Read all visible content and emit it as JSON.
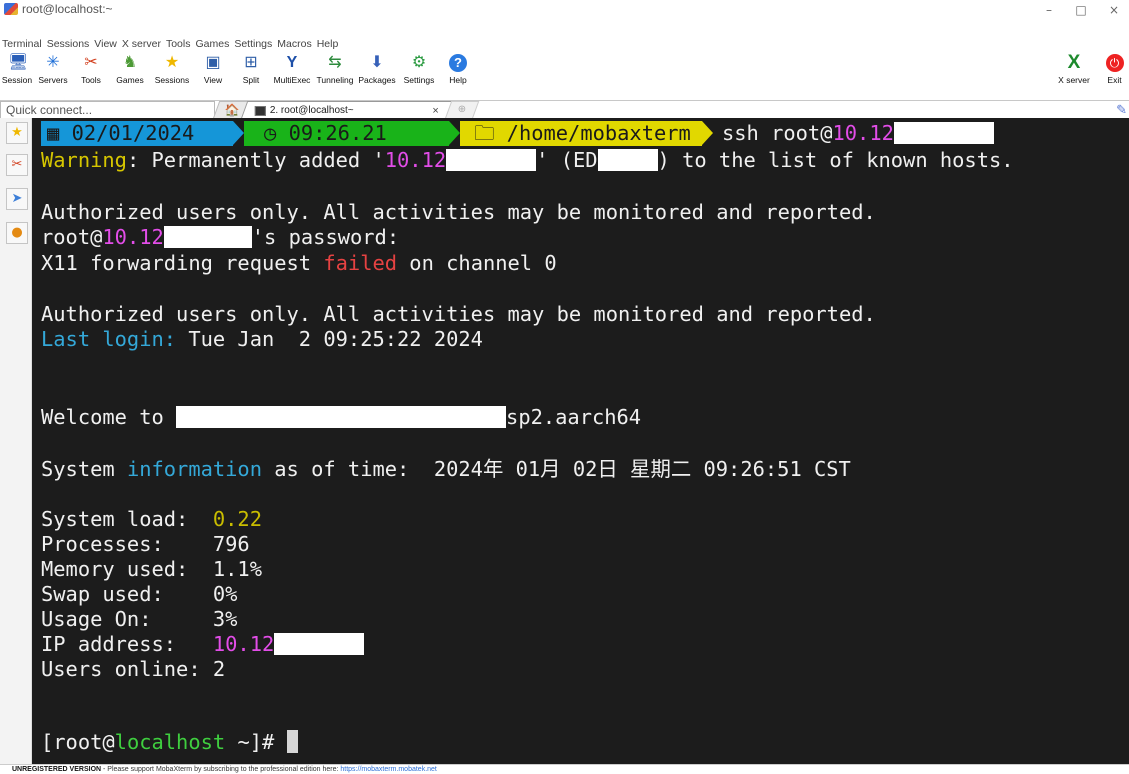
{
  "window": {
    "title": "root@localhost:~",
    "controls": [
      "–",
      "□",
      "×"
    ]
  },
  "menu": [
    "Terminal",
    "Sessions",
    "View",
    "X server",
    "Tools",
    "Games",
    "Settings",
    "Macros",
    "Help"
  ],
  "toolbar": [
    {
      "label": "Session",
      "icon": "session-icon",
      "glyph": "🖥"
    },
    {
      "label": "Servers",
      "icon": "servers-icon",
      "glyph": "✳"
    },
    {
      "label": "Tools",
      "icon": "tools-icon",
      "glyph": "✂"
    },
    {
      "label": "Games",
      "icon": "games-icon",
      "glyph": "♞"
    },
    {
      "label": "Sessions",
      "icon": "star-icon",
      "glyph": "★"
    },
    {
      "label": "View",
      "icon": "view-icon",
      "glyph": "▣"
    },
    {
      "label": "Split",
      "icon": "split-icon",
      "glyph": "⊞"
    },
    {
      "label": "MultiExec",
      "icon": "multiexec-icon",
      "glyph": "Y"
    },
    {
      "label": "Tunneling",
      "icon": "tunneling-icon",
      "glyph": "⇆"
    },
    {
      "label": "Packages",
      "icon": "packages-icon",
      "glyph": "⬇"
    },
    {
      "label": "Settings",
      "icon": "settings-icon",
      "glyph": "⚙"
    },
    {
      "label": "Help",
      "icon": "help-icon",
      "glyph": "?"
    },
    {
      "label": "X server",
      "icon": "xserver-icon",
      "glyph": "X"
    },
    {
      "label": "Exit",
      "icon": "exit-icon",
      "glyph": "⏻"
    }
  ],
  "tabs": {
    "quick_connect_placeholder": "Quick connect...",
    "home_glyph": "🏠",
    "active_tab_label": "2. root@localhost~",
    "close_glyph": "×",
    "new_tab_glyph": "⊕"
  },
  "prompt": {
    "date": "02/01/2024",
    "time": "09:26.21",
    "path": "/home/mobaxterm",
    "command_prefix": "ssh root@",
    "command_ip": "10.12"
  },
  "terminal": {
    "warning_label": "Warning",
    "warning_text": ": Permanently added '",
    "warning_ip": "10.12",
    "warning_mid": "' (ED",
    "warning_end": ") to the list of known hosts.",
    "authorized_1": "Authorized users only. All activities may be monitored and reported.",
    "pw_user": "root@",
    "pw_ip": "10.12",
    "pw_suffix": "'s password:",
    "x11_a": "X11 forwarding request ",
    "x11_failed": "failed",
    "x11_b": " on channel 0",
    "authorized_2": "Authorized users only. All activities may be monitored and reported.",
    "last_login_label": "Last login:",
    "last_login_value": " Tue Jan  2 09:25:22 2024",
    "welcome_prefix": "Welcome to ",
    "welcome_suffix": "sp2.aarch64",
    "sysinfo_a": "System ",
    "sysinfo_info": "information",
    "sysinfo_b": " as of time:  2024年 01月 02日 星期二 09:26:51 CST",
    "stats": [
      {
        "label": "System load:  ",
        "value": "0.22"
      },
      {
        "label": "Processes:    ",
        "value": "796"
      },
      {
        "label": "Memory used:  ",
        "value": "1.1%"
      },
      {
        "label": "Swap used:    ",
        "value": "0%"
      },
      {
        "label": "Usage On:     ",
        "value": "3%"
      },
      {
        "label": "IP address:   ",
        "value": "10.12"
      },
      {
        "label": "Users online: ",
        "value": "2"
      }
    ],
    "final_open": "[root@",
    "final_host": "localhost",
    "final_close": " ~]# "
  },
  "statusbar": {
    "bold": "UNREGISTERED VERSION",
    "text": "  -  Please support MobaXterm by subscribing to the professional edition here: ",
    "link": "https://mobaxterm.mobatek.net"
  },
  "colors": {
    "terminal_bg": "#1c1c1c",
    "date_segment": "#1596d8",
    "time_segment": "#19b319",
    "path_segment": "#e1d800",
    "magenta": "#e24de8",
    "red": "#e64242",
    "cyan": "#34a8d8"
  }
}
